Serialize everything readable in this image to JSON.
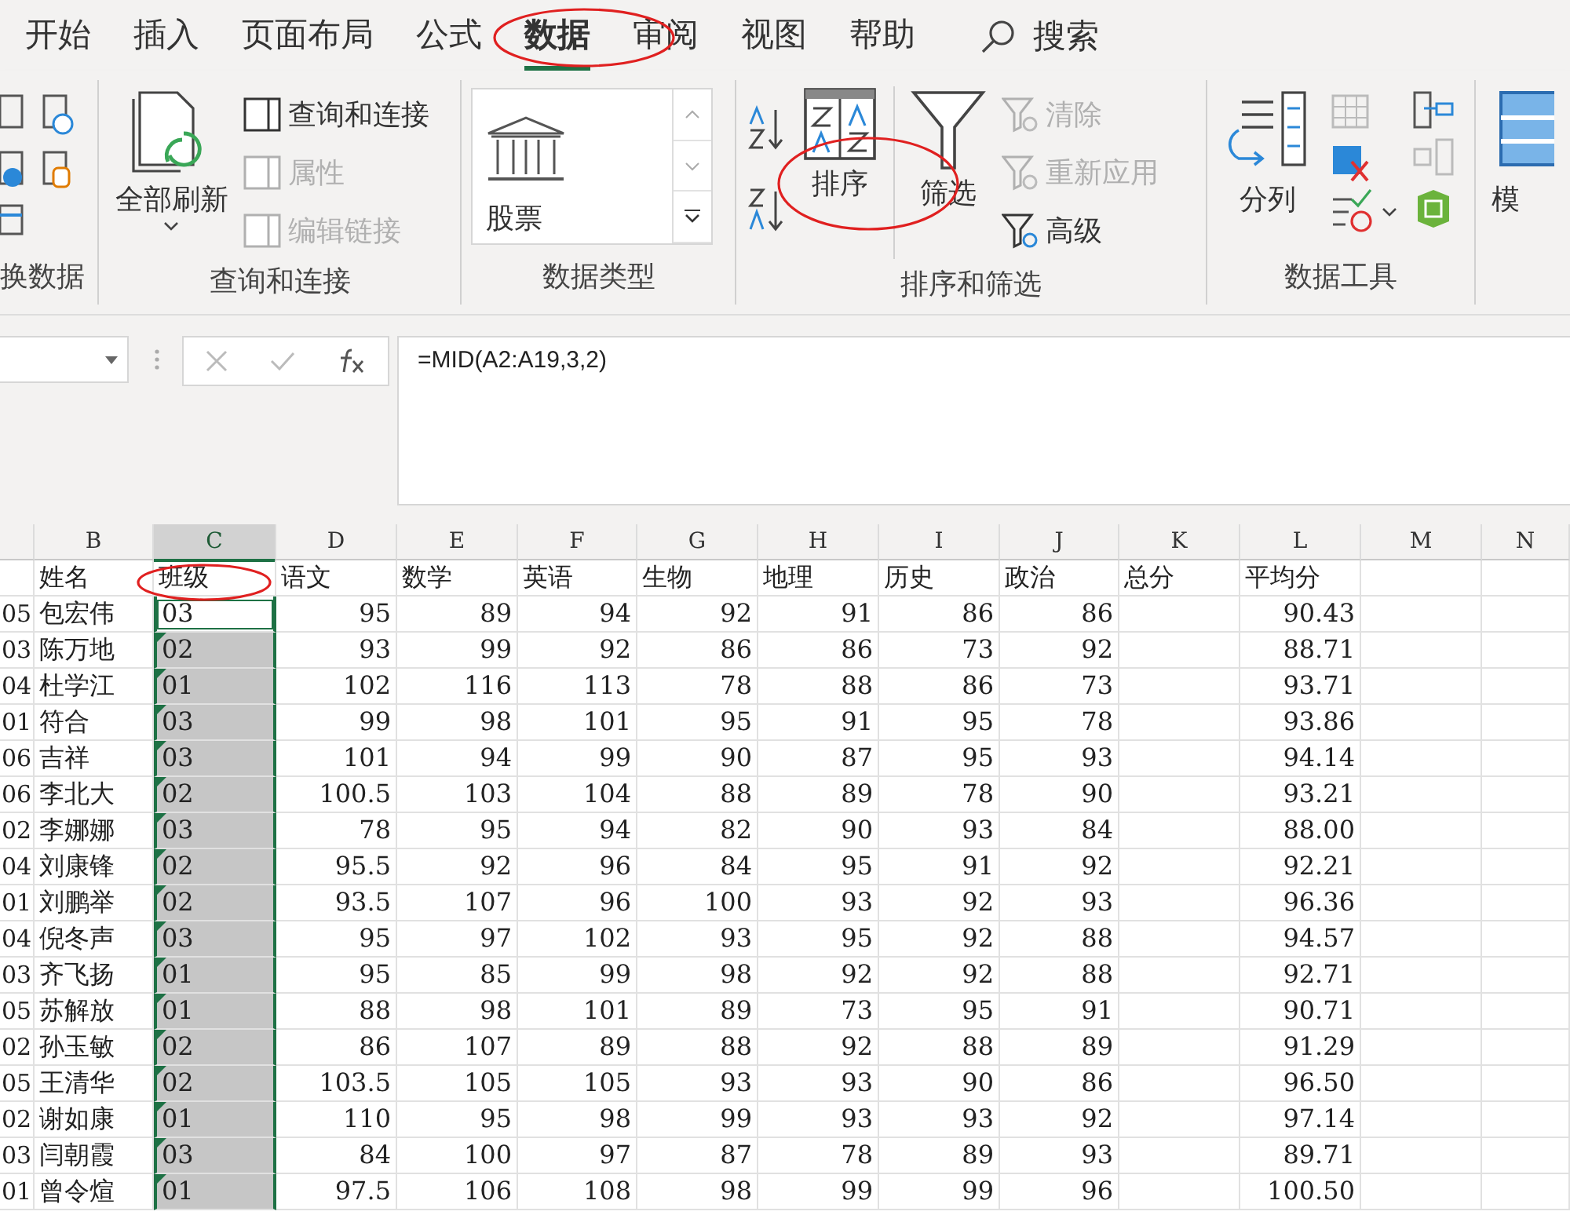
{
  "tabs": [
    {
      "label": "开始",
      "selected": false
    },
    {
      "label": "插入",
      "selected": false
    },
    {
      "label": "页面布局",
      "selected": false
    },
    {
      "label": "公式",
      "selected": false
    },
    {
      "label": "数据",
      "selected": true
    },
    {
      "label": "审阅",
      "selected": false
    },
    {
      "label": "视图",
      "selected": false
    },
    {
      "label": "帮助",
      "selected": false
    }
  ],
  "search": {
    "label": "搜索"
  },
  "ribbon": {
    "get_data": {
      "label": "换数据"
    },
    "queries": {
      "label": "查询和连接",
      "refresh": {
        "label": "全部刷新"
      },
      "items": [
        {
          "label": "查询和连接",
          "disabled": false
        },
        {
          "label": "属性",
          "disabled": true
        },
        {
          "label": "编辑链接",
          "disabled": true
        }
      ]
    },
    "data_types": {
      "label": "数据类型",
      "gallery": [
        {
          "label": "股票"
        }
      ]
    },
    "sort_filter": {
      "label": "排序和筛选",
      "sort": {
        "label": "排序"
      },
      "filter": {
        "label": "筛选"
      },
      "items": [
        {
          "label": "清除",
          "disabled": true
        },
        {
          "label": "重新应用",
          "disabled": true
        },
        {
          "label": "高级",
          "disabled": false
        }
      ]
    },
    "data_tools": {
      "label": "数据工具",
      "split": {
        "label": "分列"
      }
    },
    "what_if": {
      "label": "模"
    }
  },
  "formula_bar": {
    "formula": "=MID(A2:A19,3,2)"
  },
  "sheet": {
    "columns": [
      {
        "label": "B",
        "selected": false
      },
      {
        "label": "C",
        "selected": true
      },
      {
        "label": "D",
        "selected": false
      },
      {
        "label": "E",
        "selected": false
      },
      {
        "label": "F",
        "selected": false
      },
      {
        "label": "G",
        "selected": false
      },
      {
        "label": "H",
        "selected": false
      },
      {
        "label": "I",
        "selected": false
      },
      {
        "label": "J",
        "selected": false
      },
      {
        "label": "K",
        "selected": false
      },
      {
        "label": "L",
        "selected": false
      },
      {
        "label": "M",
        "selected": false
      },
      {
        "label": "N",
        "selected": false
      }
    ],
    "header": [
      "姓名",
      "班级",
      "语文",
      "数学",
      "英语",
      "生物",
      "地理",
      "历史",
      "政治",
      "总分",
      "平均分"
    ],
    "rows": [
      {
        "a": "05",
        "name": "包宏伟",
        "class": "03",
        "scores": [
          "95",
          "89",
          "94",
          "92",
          "91",
          "86",
          "86"
        ],
        "average": "90.43",
        "active": true,
        "selected": true,
        "error_flag": false
      },
      {
        "a": "03",
        "name": "陈万地",
        "class": "02",
        "scores": [
          "93",
          "99",
          "92",
          "86",
          "86",
          "73",
          "92"
        ],
        "average": "88.71",
        "active": false,
        "selected": true,
        "error_flag": true
      },
      {
        "a": "04",
        "name": "杜学江",
        "class": "01",
        "scores": [
          "102",
          "116",
          "113",
          "78",
          "88",
          "86",
          "73"
        ],
        "average": "93.71",
        "active": false,
        "selected": true,
        "error_flag": true
      },
      {
        "a": "01",
        "name": "符合",
        "class": "03",
        "scores": [
          "99",
          "98",
          "101",
          "95",
          "91",
          "95",
          "78"
        ],
        "average": "93.86",
        "active": false,
        "selected": true,
        "error_flag": true
      },
      {
        "a": "06",
        "name": "吉祥",
        "class": "03",
        "scores": [
          "101",
          "94",
          "99",
          "90",
          "87",
          "95",
          "93"
        ],
        "average": "94.14",
        "active": false,
        "selected": true,
        "error_flag": true
      },
      {
        "a": "06",
        "name": "李北大",
        "class": "02",
        "scores": [
          "100.5",
          "103",
          "104",
          "88",
          "89",
          "78",
          "90"
        ],
        "average": "93.21",
        "active": false,
        "selected": true,
        "error_flag": true
      },
      {
        "a": "02",
        "name": "李娜娜",
        "class": "03",
        "scores": [
          "78",
          "95",
          "94",
          "82",
          "90",
          "93",
          "84"
        ],
        "average": "88.00",
        "active": false,
        "selected": true,
        "error_flag": true
      },
      {
        "a": "04",
        "name": "刘康锋",
        "class": "02",
        "scores": [
          "95.5",
          "92",
          "96",
          "84",
          "95",
          "91",
          "92"
        ],
        "average": "92.21",
        "active": false,
        "selected": true,
        "error_flag": true
      },
      {
        "a": "01",
        "name": "刘鹏举",
        "class": "02",
        "scores": [
          "93.5",
          "107",
          "96",
          "100",
          "93",
          "92",
          "93"
        ],
        "average": "96.36",
        "active": false,
        "selected": true,
        "error_flag": true
      },
      {
        "a": "04",
        "name": "倪冬声",
        "class": "03",
        "scores": [
          "95",
          "97",
          "102",
          "93",
          "95",
          "92",
          "88"
        ],
        "average": "94.57",
        "active": false,
        "selected": true,
        "error_flag": true
      },
      {
        "a": "03",
        "name": "齐飞扬",
        "class": "01",
        "scores": [
          "95",
          "85",
          "99",
          "98",
          "92",
          "92",
          "88"
        ],
        "average": "92.71",
        "active": false,
        "selected": true,
        "error_flag": true
      },
      {
        "a": "05",
        "name": "苏解放",
        "class": "01",
        "scores": [
          "88",
          "98",
          "101",
          "89",
          "73",
          "95",
          "91"
        ],
        "average": "90.71",
        "active": false,
        "selected": true,
        "error_flag": true
      },
      {
        "a": "02",
        "name": "孙玉敏",
        "class": "02",
        "scores": [
          "86",
          "107",
          "89",
          "88",
          "92",
          "88",
          "89"
        ],
        "average": "91.29",
        "active": false,
        "selected": true,
        "error_flag": true
      },
      {
        "a": "05",
        "name": "王清华",
        "class": "02",
        "scores": [
          "103.5",
          "105",
          "105",
          "93",
          "93",
          "90",
          "86"
        ],
        "average": "96.50",
        "active": false,
        "selected": true,
        "error_flag": true
      },
      {
        "a": "02",
        "name": "谢如康",
        "class": "01",
        "scores": [
          "110",
          "95",
          "98",
          "99",
          "93",
          "93",
          "92"
        ],
        "average": "97.14",
        "active": false,
        "selected": true,
        "error_flag": true
      },
      {
        "a": "03",
        "name": "闫朝霞",
        "class": "03",
        "scores": [
          "84",
          "100",
          "97",
          "87",
          "78",
          "89",
          "93"
        ],
        "average": "89.71",
        "active": false,
        "selected": true,
        "error_flag": true
      },
      {
        "a": "01",
        "name": "曾令煊",
        "class": "01",
        "scores": [
          "97.5",
          "106",
          "108",
          "98",
          "99",
          "99",
          "96"
        ],
        "average": "100.50",
        "active": false,
        "selected": true,
        "error_flag": true
      }
    ]
  }
}
